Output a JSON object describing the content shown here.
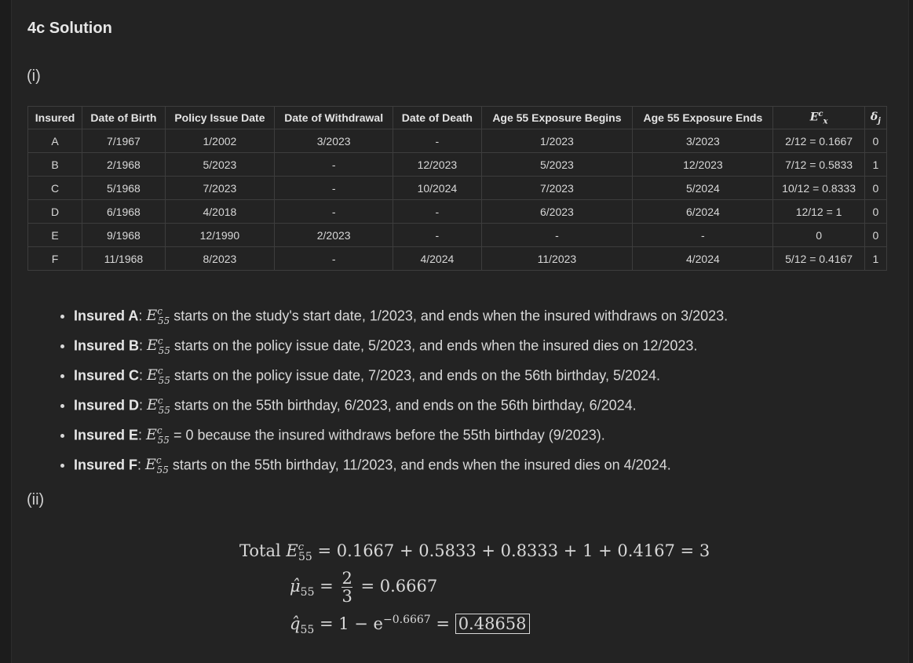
{
  "title": "4c Solution",
  "part_i": "(i)",
  "part_ii": "(ii)",
  "table": {
    "headers": [
      "Insured",
      "Date of Birth",
      "Policy Issue Date",
      "Date of Withdrawal",
      "Date of Death",
      "Age 55 Exposure Begins",
      "Age 55 Exposure Ends",
      "E",
      "δ"
    ],
    "rows": [
      [
        "A",
        "7/1967",
        "1/2002",
        "3/2023",
        "-",
        "1/2023",
        "3/2023",
        "2/12 = 0.1667",
        "0"
      ],
      [
        "B",
        "2/1968",
        "5/2023",
        "-",
        "12/2023",
        "5/2023",
        "12/2023",
        "7/12 = 0.5833",
        "1"
      ],
      [
        "C",
        "5/1968",
        "7/2023",
        "-",
        "10/2024",
        "7/2023",
        "5/2024",
        "10/12 = 0.8333",
        "0"
      ],
      [
        "D",
        "6/1968",
        "4/2018",
        "-",
        "-",
        "6/2023",
        "6/2024",
        "12/12 = 1",
        "0"
      ],
      [
        "E",
        "9/1968",
        "12/1990",
        "2/2023",
        "-",
        "-",
        "-",
        "0",
        "0"
      ],
      [
        "F",
        "11/1968",
        "8/2023",
        "-",
        "4/2024",
        "11/2023",
        "4/2024",
        "5/12 = 0.4167",
        "1"
      ]
    ]
  },
  "bullets": [
    {
      "name": "Insured A",
      "text": " starts on the study's start date, 1/2023, and ends when the insured withdraws on 3/2023."
    },
    {
      "name": "Insured B",
      "text": " starts on the policy issue date, 5/2023, and ends when the insured dies on 12/2023."
    },
    {
      "name": "Insured C",
      "text": " starts on the policy issue date, 7/2023, and ends on the 56th birthday, 5/2024."
    },
    {
      "name": "Insured D",
      "text": " starts on the 55th birthday, 6/2023, and ends on the 56th birthday, 6/2024."
    },
    {
      "name": "Insured E",
      "text": " = 0 because the insured withdraws before the 55th birthday (9/2023)."
    },
    {
      "name": "Insured F",
      "text": " starts on the 55th birthday, 11/2023, and ends when the insured dies on 4/2024."
    }
  ],
  "math": {
    "total_label": "Total",
    "total_sum": "= 0.1667 + 0.5833 + 0.8333 + 1 + 0.4167 = 3",
    "mu_num": "2",
    "mu_den": "3",
    "mu_result": "= 0.6667",
    "q_expr": "= 1 − e",
    "q_exp": "−0.6667",
    "q_eq": "=",
    "q_result": "0.48658"
  }
}
